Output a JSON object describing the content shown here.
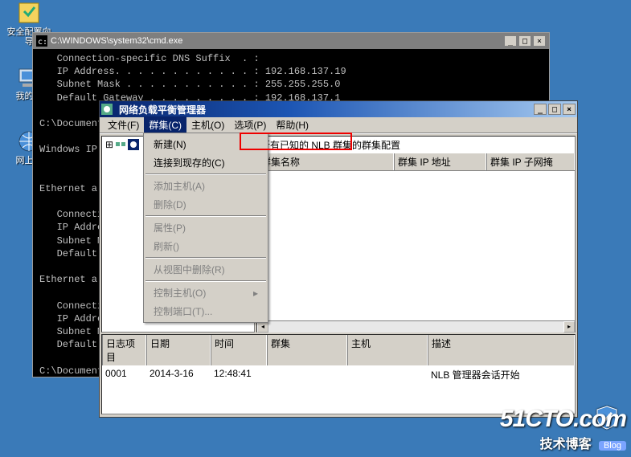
{
  "desktop": {
    "icons": [
      {
        "label": "安全配置向导"
      },
      {
        "label": "我的电"
      },
      {
        "label": "网上邻"
      }
    ]
  },
  "cmd": {
    "title": "C:\\WINDOWS\\system32\\cmd.exe",
    "lines": {
      "l0": "   Connection-specific DNS Suffix  . :",
      "l1": "   IP Address. . . . . . . . . . . . : 192.168.137.19",
      "l2": "   Subnet Mask . . . . . . . . . . . : 255.255.255.0",
      "l3": "   Default Gateway . . . . . . . . . : 192.168.137.1",
      "l4": "",
      "l5": "C:\\Document",
      "l6": "",
      "l7": "Windows IP",
      "l8": "",
      "l9": "",
      "l10": "Ethernet a",
      "l11": "",
      "l12": "   Connecti",
      "l13": "   IP Addre",
      "l14": "   Subnet M",
      "l15": "   Default ",
      "l16": "",
      "l17": "Ethernet a",
      "l18": "",
      "l19": "   Connecti",
      "l20": "   IP Addre",
      "l21": "   Subnet M",
      "l22": "   Default ",
      "l23": "",
      "l24": "C:\\Document"
    }
  },
  "nlb": {
    "title": "网络负载平衡管理器",
    "menus": {
      "file": "文件(F)",
      "cluster": "群集(C)",
      "host": "主机(O)",
      "options": "选项(P)",
      "help": "帮助(H)"
    },
    "dropdown": {
      "new": "新建(N)",
      "connect": "连接到现存的(C)",
      "addhost": "添加主机(A)",
      "delete": "删除(D)",
      "properties": "属性(P)",
      "refresh": "刷新()",
      "removefromview": "从视图中删除(R)",
      "controlhost": "控制主机(O)",
      "controlport": "控制端口(T)...",
      "arrow": "▸"
    },
    "list": {
      "caption": "所有已知的 NLB 群集的群集配置",
      "col1": "群集名称",
      "col2": "群集 IP 地址",
      "col3": "群集 IP 子网掩"
    },
    "log": {
      "h1": "日志项目",
      "h2": "日期",
      "h3": "时间",
      "h4": "群集",
      "h5": "主机",
      "h6": "描述",
      "rows": [
        {
          "id": "0001",
          "date": "2014-3-16",
          "time": "12:48:41",
          "cluster": "",
          "host": "",
          "desc": "NLB 管理器会话开始"
        }
      ]
    }
  },
  "watermark": {
    "line1": "51CTO.com",
    "line2": "技术博客",
    "tag": "Blog"
  }
}
